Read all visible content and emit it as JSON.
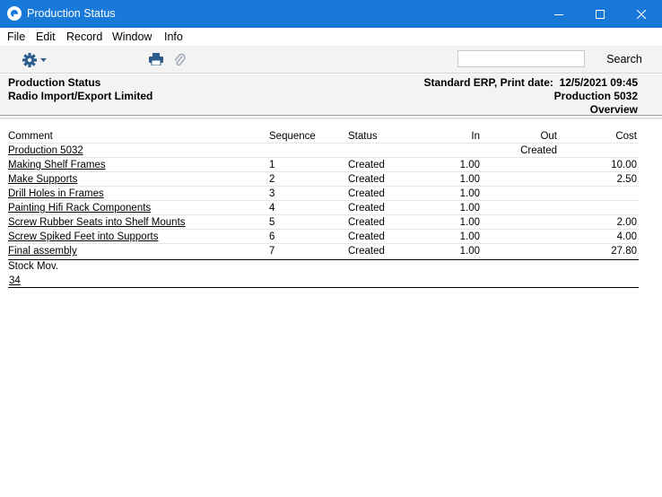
{
  "window": {
    "title": "Production Status"
  },
  "menu": [
    "File",
    "Edit",
    "Record",
    "Window",
    "Info"
  ],
  "toolbar": {
    "search_value": "",
    "search_label": "Search"
  },
  "header": {
    "report_name": "Production Status",
    "company": "Radio Import/Export Limited",
    "print_info": "Standard ERP, Print date:  12/5/2021 09:45",
    "production": "Production 5032",
    "mode": "Overview"
  },
  "table": {
    "columns": [
      "Comment",
      "Sequence",
      "Status",
      "In",
      "Out",
      "Cost"
    ],
    "header_row": {
      "comment": "Production 5032",
      "status": "Created"
    },
    "rows": [
      {
        "comment": "Making Shelf Frames",
        "sequence": "1",
        "status": "Created",
        "in": "1.00",
        "out": "",
        "cost": "10.00"
      },
      {
        "comment": "Make Supports",
        "sequence": "2",
        "status": "Created",
        "in": "1.00",
        "out": "",
        "cost": "2.50"
      },
      {
        "comment": "Drill Holes in Frames",
        "sequence": "3",
        "status": "Created",
        "in": "1.00",
        "out": "",
        "cost": ""
      },
      {
        "comment": "Painting Hifi Rack Components",
        "sequence": "4",
        "status": "Created",
        "in": "1.00",
        "out": "",
        "cost": ""
      },
      {
        "comment": "Screw Rubber Seats into Shelf Mounts",
        "sequence": "5",
        "status": "Created",
        "in": "1.00",
        "out": "",
        "cost": "2.00"
      },
      {
        "comment": "Screw Spiked Feet into Supports",
        "sequence": "6",
        "status": "Created",
        "in": "1.00",
        "out": "",
        "cost": "4.00"
      },
      {
        "comment": "Final assembly",
        "sequence": "7",
        "status": "Created",
        "in": "1.00",
        "out": "",
        "cost": "27.80"
      }
    ]
  },
  "stock": {
    "label": "Stock Mov.",
    "value": "34"
  }
}
